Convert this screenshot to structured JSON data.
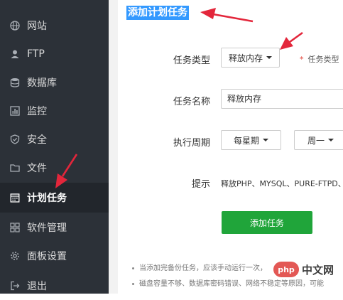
{
  "sidebar": {
    "items": [
      {
        "label": "网站",
        "icon": "globe-icon"
      },
      {
        "label": "FTP",
        "icon": "user-icon"
      },
      {
        "label": "数据库",
        "icon": "database-icon"
      },
      {
        "label": "监控",
        "icon": "monitor-icon"
      },
      {
        "label": "安全",
        "icon": "shield-icon"
      },
      {
        "label": "文件",
        "icon": "folder-icon"
      },
      {
        "label": "计划任务",
        "icon": "calendar-icon",
        "active": true
      },
      {
        "label": "软件管理",
        "icon": "apps-icon"
      },
      {
        "label": "面板设置",
        "icon": "gear-icon"
      },
      {
        "label": "退出",
        "icon": "logout-icon"
      }
    ]
  },
  "main": {
    "title": "添加计划任务",
    "form": {
      "task_type_label": "任务类型",
      "task_type_value": "释放内存",
      "task_type_note": "任务类型",
      "task_name_label": "任务名称",
      "task_name_value": "释放内存",
      "cycle_label": "执行周期",
      "cycle_value": "每星期",
      "weekday_value": "周一",
      "hint_label": "提示",
      "hint_text": "释放PHP、MYSQL、PURE-FTPD、",
      "submit_label": "添加任务"
    },
    "notes": [
      "当添加完备份任务，应该手动运行一次，",
      "磁盘容量不够、数据库密码错误、网络不稳定等原因，可能"
    ]
  },
  "watermark": {
    "badge": "php",
    "text": "中文网"
  },
  "colors": {
    "sidebar_bg": "#2c3138",
    "active_bg": "#22262c",
    "title_highlight": "#3399ff",
    "submit_button": "#20a53a",
    "annotation_arrow": "#e3263b"
  }
}
